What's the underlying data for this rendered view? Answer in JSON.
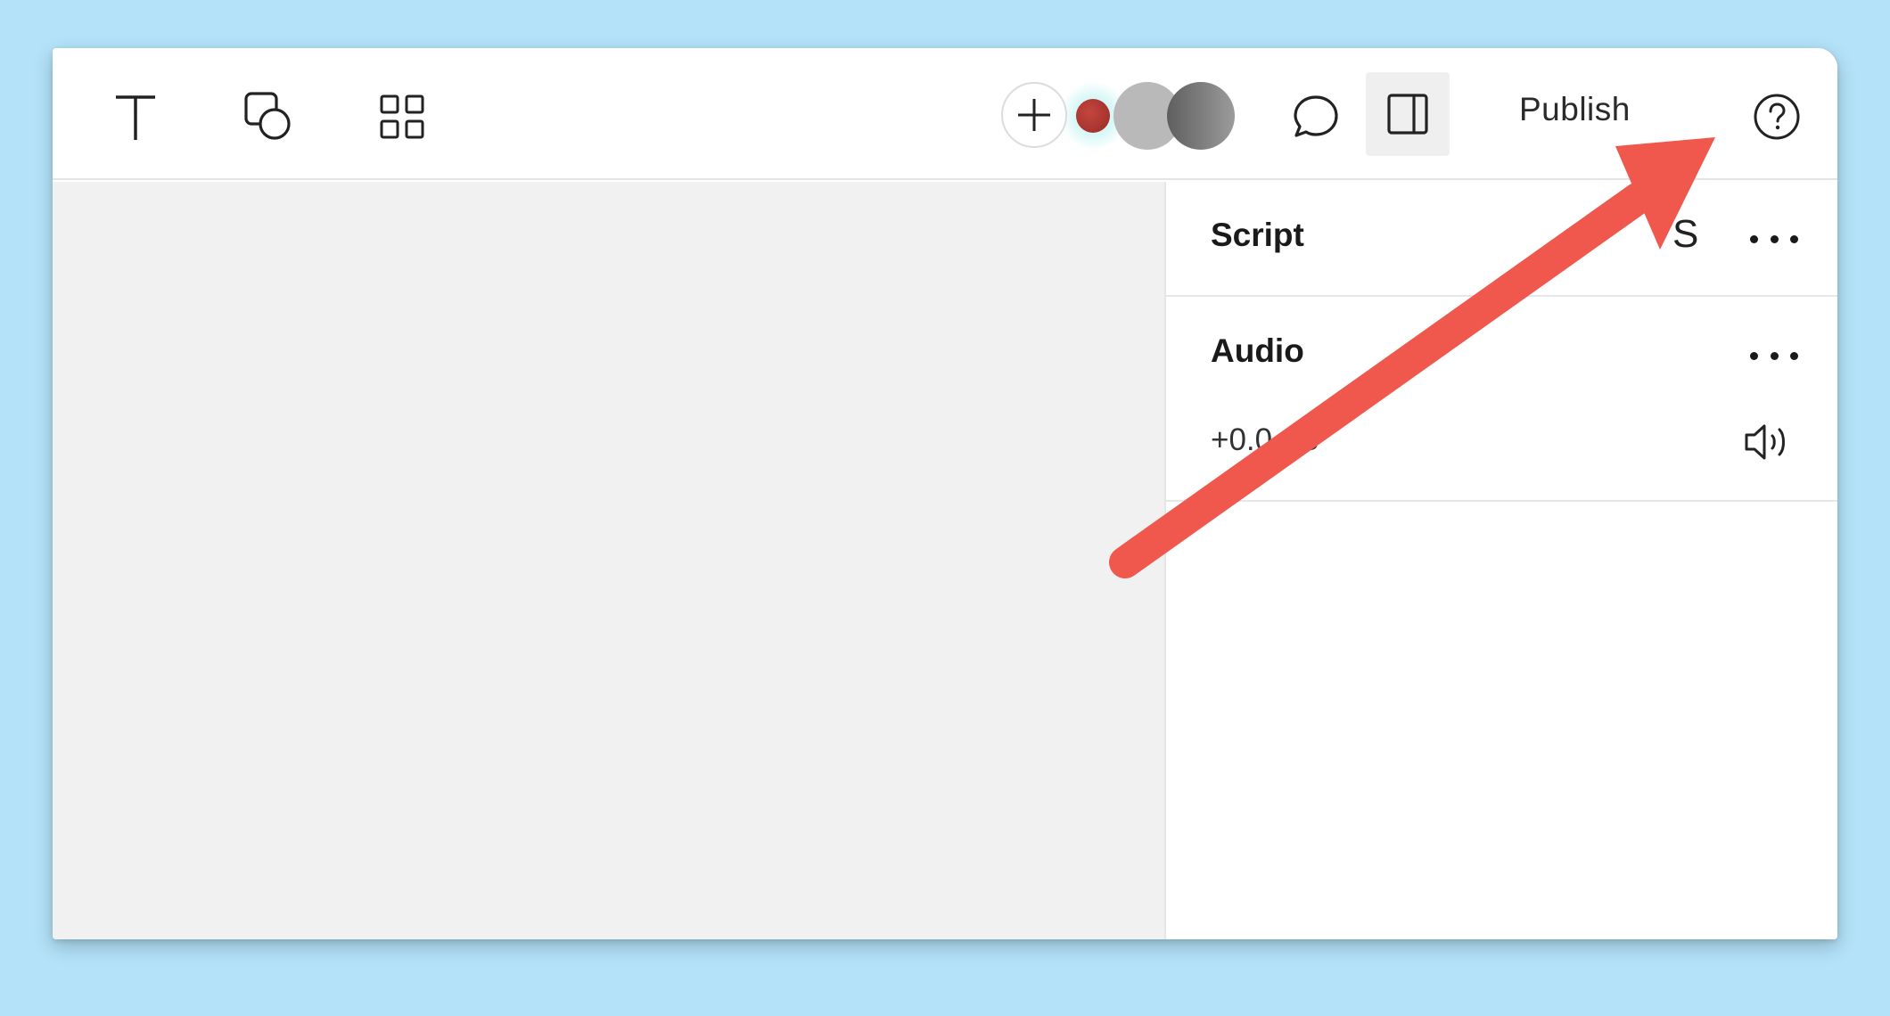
{
  "toolbar": {
    "publish_label": "Publish",
    "icons": [
      "text-tool-icon",
      "shapes-tool-icon",
      "grid-elements-icon",
      "add-collaborator-icon",
      "comment-icon",
      "panel-toggle-icon",
      "help-icon"
    ]
  },
  "panel": {
    "script": {
      "title": "Script",
      "letter": "S"
    },
    "audio": {
      "title": "Audio",
      "volume": "+0.0 dB"
    }
  },
  "colors": {
    "background": "#b3e2f9",
    "canvas": "#f1f1f1",
    "annotation_arrow": "#f0584d"
  }
}
